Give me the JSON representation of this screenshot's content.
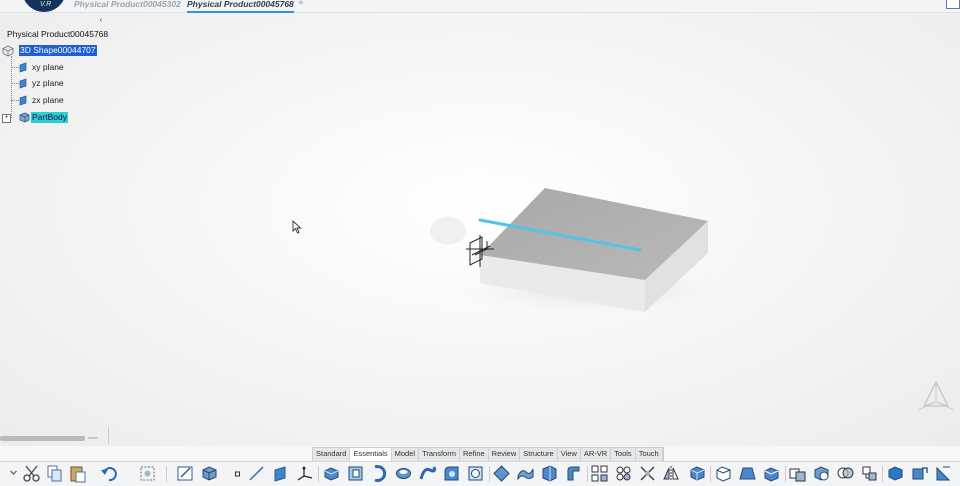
{
  "tabs": [
    {
      "label": "Physical Product00045302",
      "active": false
    },
    {
      "label": "Physical Product00045768",
      "active": true
    }
  ],
  "logo_text": "V.R",
  "tree": {
    "collapse_glyph": "‹",
    "root": "Physical Product00045768",
    "items": [
      {
        "label": "3D Shape00044707",
        "state": "selected"
      },
      {
        "label": "xy plane",
        "state": "normal"
      },
      {
        "label": "yz plane",
        "state": "normal"
      },
      {
        "label": "zx plane",
        "state": "normal"
      },
      {
        "label": "PartBody",
        "state": "highlighted"
      }
    ]
  },
  "section_tabs": [
    "Standard",
    "Essentials",
    "Model",
    "Transform",
    "Refine",
    "Review",
    "Structure",
    "View",
    "AR-VR",
    "Tools",
    "Touch"
  ],
  "active_section": "Essentials",
  "toolbar_icons": [
    "more-chevron-icon",
    "cut-icon",
    "copy-icon",
    "paste-icon",
    "undo-icon",
    "select-icon",
    "sketch-icon",
    "part-design-icon",
    "point-icon",
    "line-icon",
    "plane-icon",
    "axis-system-icon",
    "pad-icon",
    "pocket-icon",
    "shaft-icon",
    "groove-icon",
    "rib-icon",
    "fillet-icon",
    "shell-icon",
    "split-icon",
    "surface-icon",
    "thick-surface-icon",
    "sweep-icon",
    "pattern-icon",
    "mirror-icon",
    "cut-section-icon",
    "symmetry-icon",
    "box-icon",
    "chamfer-icon",
    "draft-icon",
    "remove-face-icon",
    "boolean-add-icon",
    "boolean-remove-icon",
    "intersect-icon",
    "assemble-icon",
    "solid-icon",
    "translate-icon",
    "measure-icon"
  ],
  "colors": {
    "selection": "#1f5fd1",
    "highlight": "#2ccfd6",
    "accent_line": "#4fc3e8",
    "brand": "#14355a"
  }
}
